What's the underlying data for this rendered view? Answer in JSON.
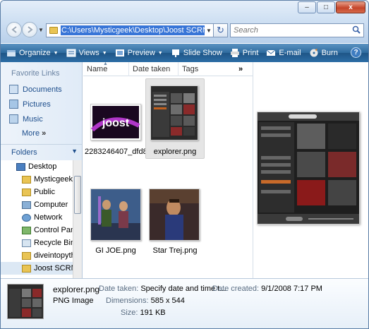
{
  "window": {
    "minimize": "–",
    "maximize": "□",
    "close": "x"
  },
  "address": {
    "path": "C:\\Users\\Mysticgeek\\Desktop\\Joost SCRN SHOTS"
  },
  "search": {
    "placeholder": "Search"
  },
  "toolbar": [
    {
      "label": "Organize",
      "icon": "organize-icon",
      "dropdown": true
    },
    {
      "label": "Views",
      "icon": "views-icon",
      "dropdown": true
    },
    {
      "label": "Preview",
      "icon": "preview-icon",
      "dropdown": true
    },
    {
      "label": "Slide Show",
      "icon": "slideshow-icon",
      "dropdown": false
    },
    {
      "label": "Print",
      "icon": "print-icon",
      "dropdown": false
    },
    {
      "label": "E-mail",
      "icon": "email-icon",
      "dropdown": false
    },
    {
      "label": "Burn",
      "icon": "burn-icon",
      "dropdown": false
    }
  ],
  "help": "?",
  "nav": {
    "favorites_title": "Favorite Links",
    "favorites": [
      "Documents",
      "Pictures",
      "Music"
    ],
    "more": "More",
    "more_glyph": "»",
    "folders_title": "Folders",
    "tree": [
      "Desktop",
      "Mysticgeek",
      "Public",
      "Computer",
      "Network",
      "Control Panel",
      "Recycle Bin",
      "diveintopython",
      "Joost SCRN SHOTS"
    ]
  },
  "columns": [
    "Name",
    "Date taken",
    "Tags"
  ],
  "columns_more": "»",
  "files": [
    {
      "name": "2283246407_dfd8...",
      "selected": false
    },
    {
      "name": "explorer.png",
      "selected": true
    },
    {
      "name": "GI JOE.png",
      "selected": false
    },
    {
      "name": "Star Trej.png",
      "selected": false
    }
  ],
  "details": {
    "file_name": "explorer.png",
    "file_type": "PNG Image",
    "date_taken_label": "Date taken:",
    "date_taken_value": "Specify date and time t...",
    "date_created_label": "Date created:",
    "date_created_value": "9/1/2008 7:17 PM",
    "dimensions_label": "Dimensions:",
    "dimensions_value": "585 x 544",
    "size_label": "Size:",
    "size_value": "191 KB"
  },
  "colors": {
    "toolbar": "#2d6a9e",
    "link": "#1d4e8c",
    "selection": "#3875d7"
  }
}
